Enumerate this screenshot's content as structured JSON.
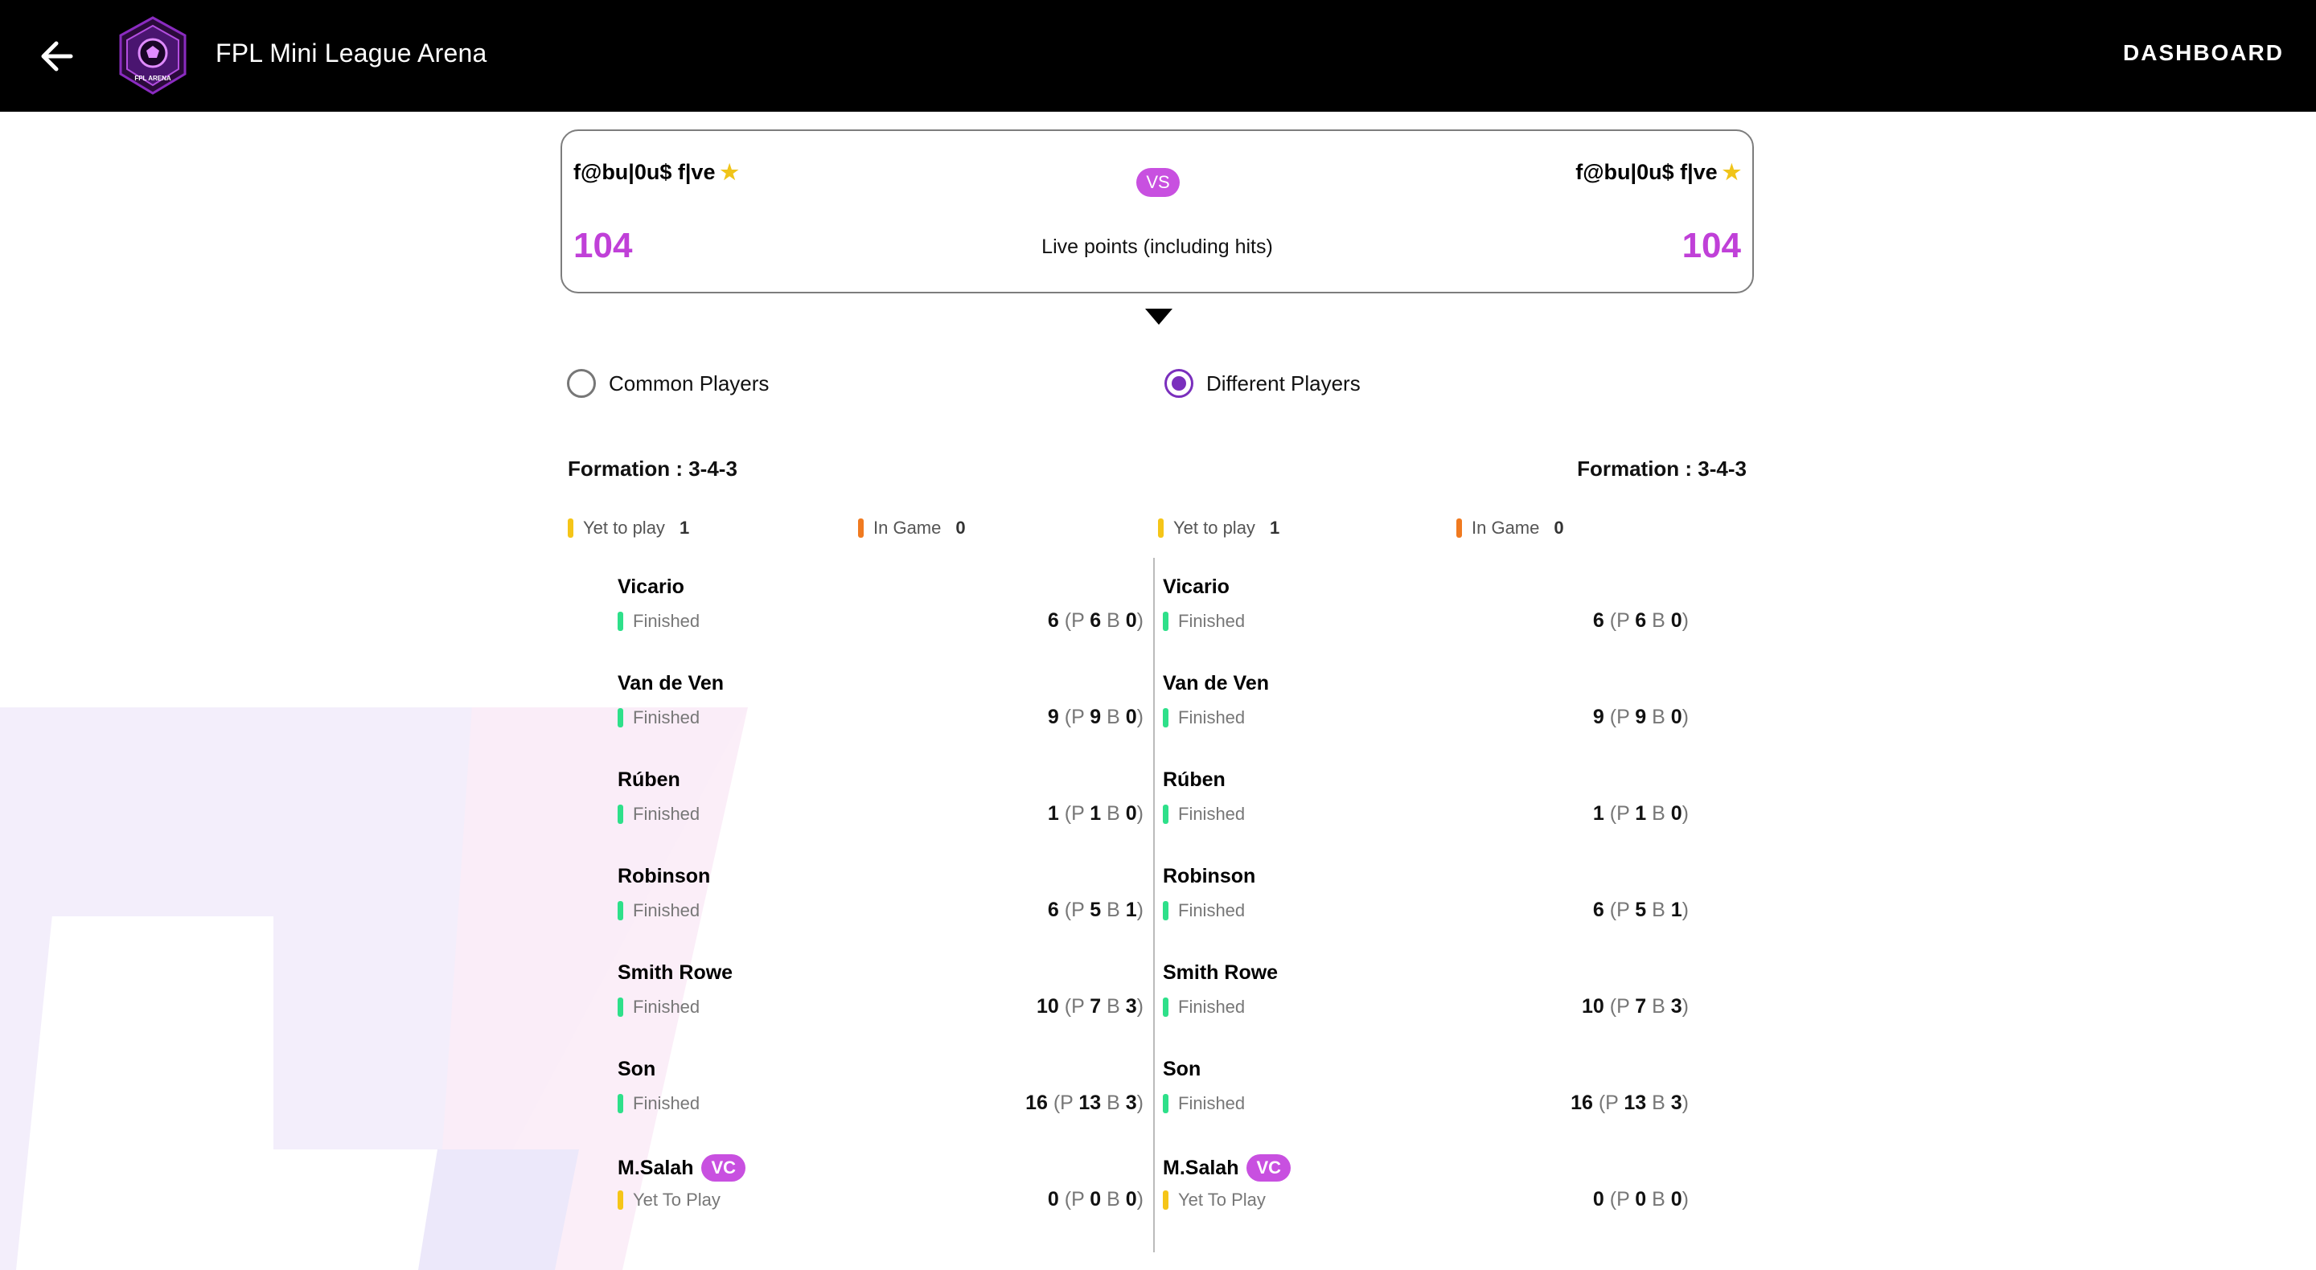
{
  "header": {
    "title": "FPL Mini League Arena",
    "dashboard_label": "DASHBOARD",
    "logo_text": "FPL ARENA"
  },
  "matchup": {
    "left_team": "f@bu|0u$ f|ve",
    "right_team": "f@bu|0u$ f|ve",
    "vs_label": "VS",
    "left_score": "104",
    "right_score": "104",
    "live_label": "Live points (including hits)"
  },
  "filters": {
    "common_label": "Common Players",
    "different_label": "Different Players",
    "selected": "Different Players"
  },
  "left": {
    "formation": "Formation : 3-4-3",
    "yet_to_play_label": "Yet to play",
    "yet_to_play": "1",
    "in_game_label": "In Game",
    "in_game": "0"
  },
  "right": {
    "formation": "Formation : 3-4-3",
    "yet_to_play_label": "Yet to play",
    "yet_to_play": "1",
    "in_game_label": "In Game",
    "in_game": "0"
  },
  "colors": {
    "accent": "#c850e0",
    "finished": "#2ee08a",
    "yet_to_play": "#f5c518",
    "in_game": "#f07a20"
  },
  "players_left": [
    {
      "name": "Vicario",
      "status": "Finished",
      "total": "6",
      "p": "6",
      "b": "0",
      "vc": ""
    },
    {
      "name": "Van de Ven",
      "status": "Finished",
      "total": "9",
      "p": "9",
      "b": "0",
      "vc": ""
    },
    {
      "name": "Rúben",
      "status": "Finished",
      "total": "1",
      "p": "1",
      "b": "0",
      "vc": ""
    },
    {
      "name": "Robinson",
      "status": "Finished",
      "total": "6",
      "p": "5",
      "b": "1",
      "vc": ""
    },
    {
      "name": "Smith Rowe",
      "status": "Finished",
      "total": "10",
      "p": "7",
      "b": "3",
      "vc": ""
    },
    {
      "name": "Son",
      "status": "Finished",
      "total": "16",
      "p": "13",
      "b": "3",
      "vc": ""
    },
    {
      "name": "M.Salah",
      "status": "Yet To Play",
      "total": "0",
      "p": "0",
      "b": "0",
      "vc": "VC"
    }
  ],
  "players_right": [
    {
      "name": "Vicario",
      "status": "Finished",
      "total": "6",
      "p": "6",
      "b": "0",
      "vc": ""
    },
    {
      "name": "Van de Ven",
      "status": "Finished",
      "total": "9",
      "p": "9",
      "b": "0",
      "vc": ""
    },
    {
      "name": "Rúben",
      "status": "Finished",
      "total": "1",
      "p": "1",
      "b": "0",
      "vc": ""
    },
    {
      "name": "Robinson",
      "status": "Finished",
      "total": "6",
      "p": "5",
      "b": "1",
      "vc": ""
    },
    {
      "name": "Smith Rowe",
      "status": "Finished",
      "total": "10",
      "p": "7",
      "b": "3",
      "vc": ""
    },
    {
      "name": "Son",
      "status": "Finished",
      "total": "16",
      "p": "13",
      "b": "3",
      "vc": ""
    },
    {
      "name": "M.Salah",
      "status": "Yet To Play",
      "total": "0",
      "p": "0",
      "b": "0",
      "vc": "VC"
    }
  ],
  "points_labels": {
    "p": "P",
    "b": "B"
  }
}
